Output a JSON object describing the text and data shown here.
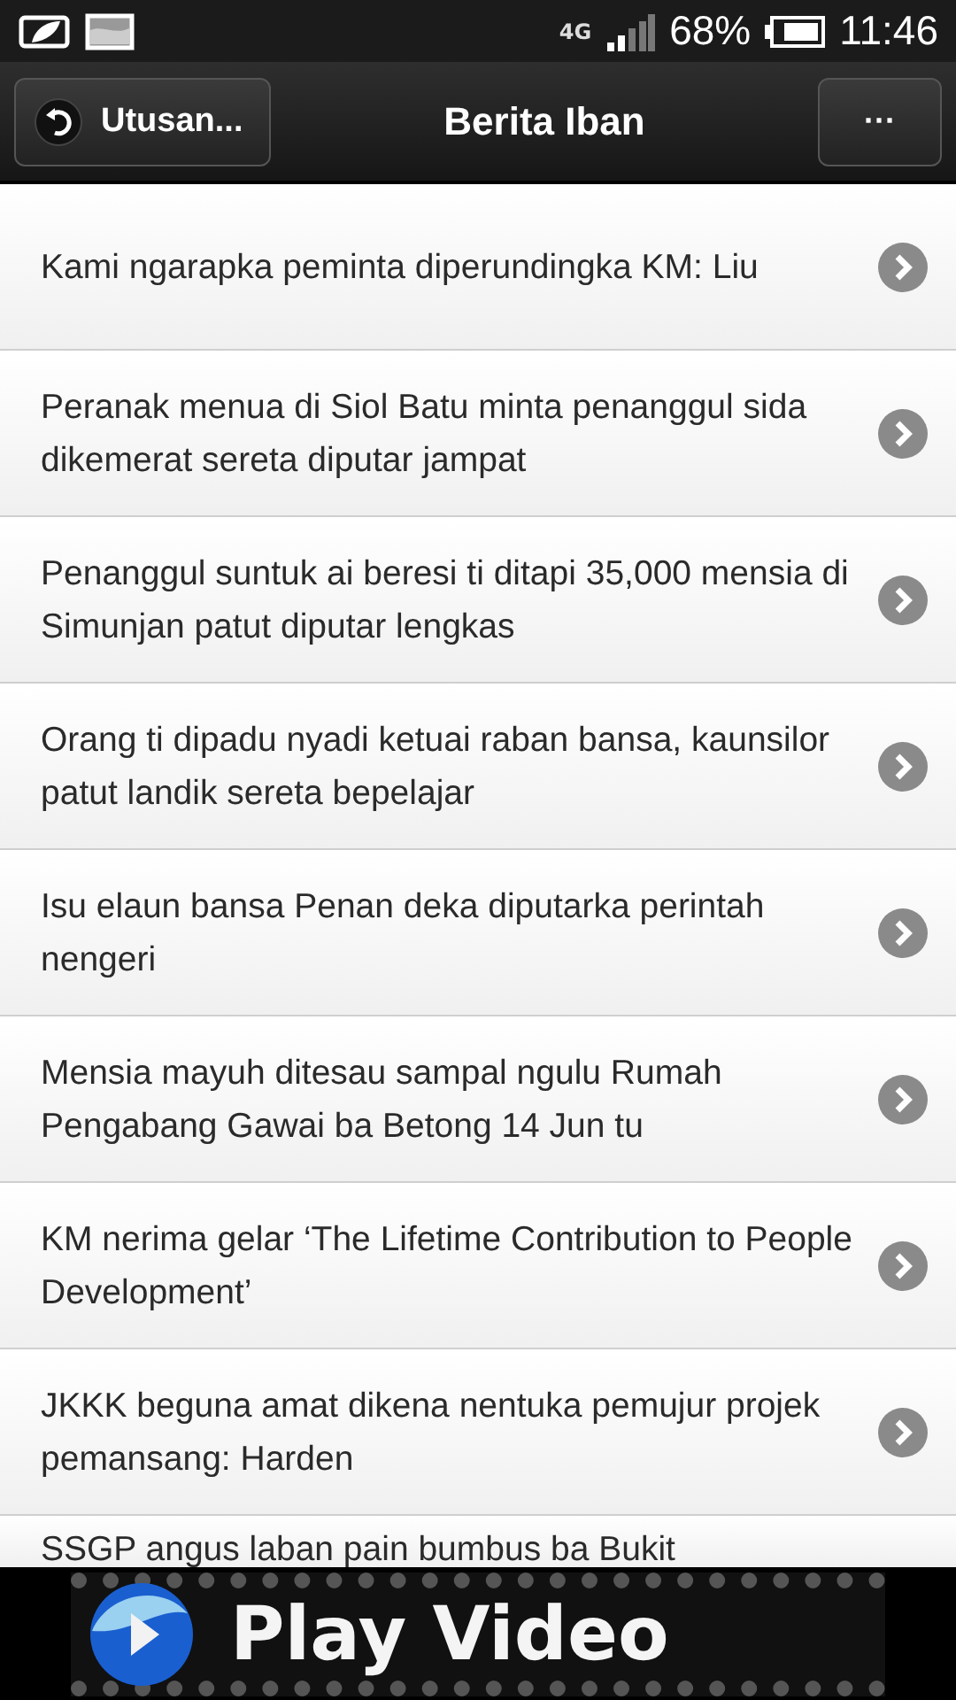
{
  "status_bar": {
    "network": "4G",
    "battery": "68%",
    "time": "11:46"
  },
  "header": {
    "back_label": "Utusan...",
    "title": "Berita Iban",
    "menu_label": "···"
  },
  "news": [
    {
      "title": "Kami ngarapka peminta diperundingka KM: Liu"
    },
    {
      "title": "Peranak menua di Siol Batu minta penanggul sida dikemerat sereta diputar jampat"
    },
    {
      "title": "Penanggul suntuk ai beresi ti ditapi 35,000 mensia di Simunjan patut diputar lengkas"
    },
    {
      "title": "Orang ti dipadu nyadi ketuai raban bansa, kaunsilor patut landik sereta bepelajar"
    },
    {
      "title": "Isu elaun bansa Penan deka diputarka perintah nengeri"
    },
    {
      "title": "Mensia mayuh ditesau sampal ngulu Rumah Pengabang Gawai ba Betong 14 Jun tu"
    },
    {
      "title": "KM nerima gelar ‘The Lifetime Contribution to People Development’"
    },
    {
      "title": "JKKK beguna amat dikena nentuka pemujur projek pemansang: Harden"
    },
    {
      "title": "SSGP angus laban pain bumbus ba Bukit"
    }
  ],
  "ad": {
    "label": "Play Video"
  }
}
